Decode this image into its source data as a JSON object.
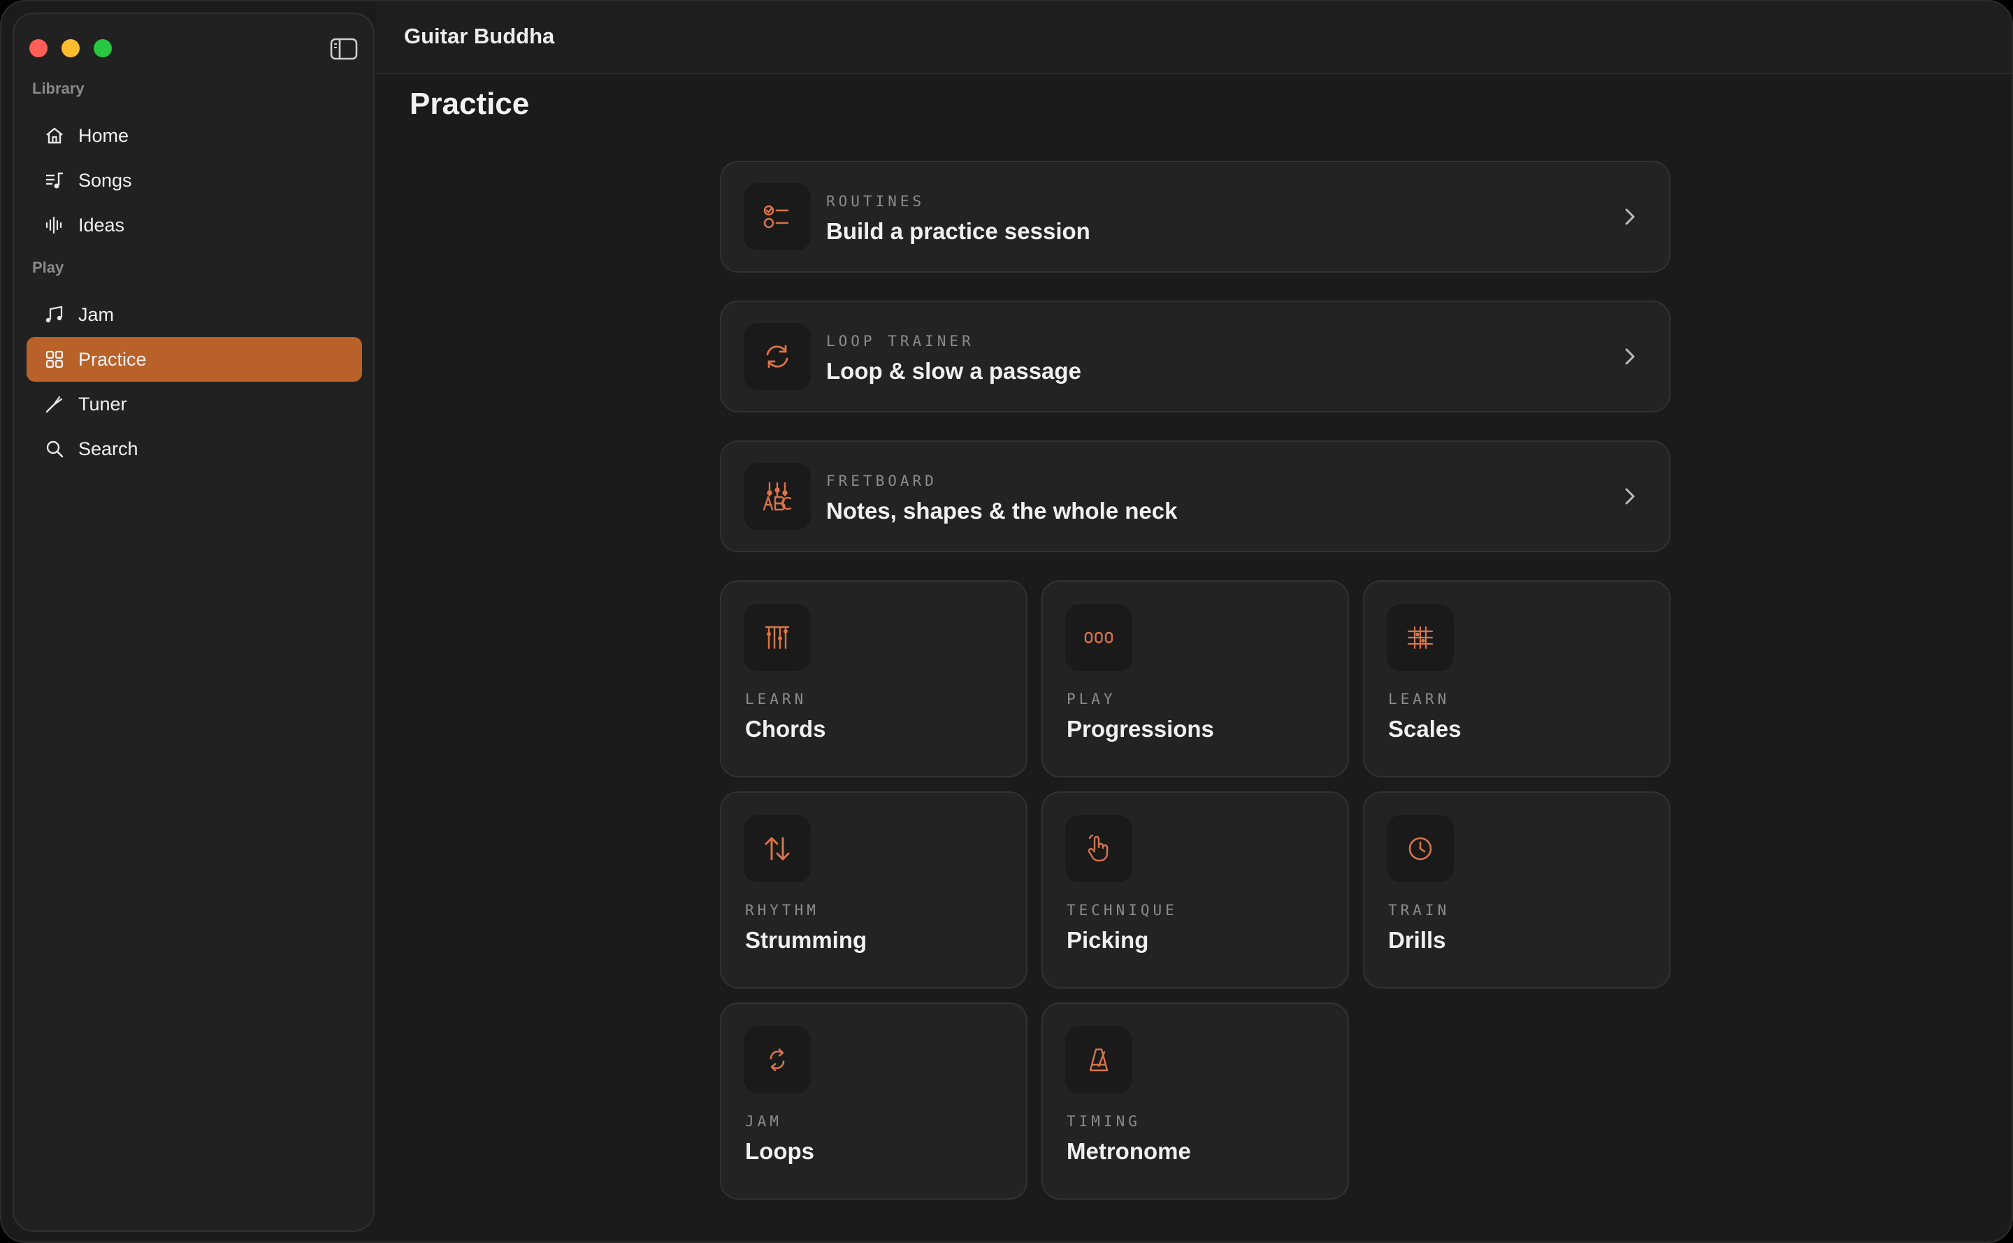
{
  "app": {
    "title": "Guitar Buddha"
  },
  "sidebar": {
    "sections": [
      {
        "label": "Library",
        "items": [
          {
            "label": "Home",
            "icon": "house-icon"
          },
          {
            "label": "Songs",
            "icon": "music-list-icon"
          },
          {
            "label": "Ideas",
            "icon": "waveform-icon"
          }
        ]
      },
      {
        "label": "Play",
        "items": [
          {
            "label": "Jam",
            "icon": "music-notes-icon"
          },
          {
            "label": "Practice",
            "icon": "grid-icon",
            "active": true
          },
          {
            "label": "Tuner",
            "icon": "tuning-fork-icon"
          },
          {
            "label": "Search",
            "icon": "search-icon"
          }
        ]
      }
    ]
  },
  "page": {
    "title": "Practice"
  },
  "wide_cards": [
    {
      "eyebrow": "ROUTINES",
      "label": "Build a practice session",
      "icon": "checklist-icon"
    },
    {
      "eyebrow": "LOOP TRAINER",
      "label": "Loop & slow a passage",
      "icon": "loop-arrows-icon"
    },
    {
      "eyebrow": "FRETBOARD",
      "label": "Notes, shapes & the whole neck",
      "icon": "fretboard-icon"
    }
  ],
  "tiles": [
    {
      "eyebrow": "LEARN",
      "label": "Chords",
      "icon": "chord-diagram-icon"
    },
    {
      "eyebrow": "PLAY",
      "label": "Progressions",
      "icon": "progression-icon"
    },
    {
      "eyebrow": "LEARN",
      "label": "Scales",
      "icon": "scale-grid-icon"
    },
    {
      "eyebrow": "RHYTHM",
      "label": "Strumming",
      "icon": "up-down-arrows-icon"
    },
    {
      "eyebrow": "TECHNIQUE",
      "label": "Picking",
      "icon": "hand-pointer-icon"
    },
    {
      "eyebrow": "TRAIN",
      "label": "Drills",
      "icon": "clock-icon"
    },
    {
      "eyebrow": "JAM",
      "label": "Loops",
      "icon": "cycle-icon"
    },
    {
      "eyebrow": "TIMING",
      "label": "Metronome",
      "icon": "metronome-icon"
    }
  ],
  "colors": {
    "accent": "#b8622a",
    "icon_accent": "#d8744a"
  }
}
